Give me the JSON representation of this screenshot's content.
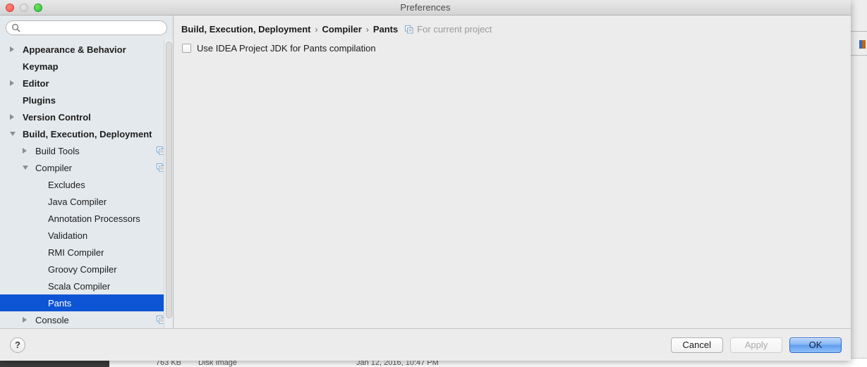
{
  "window": {
    "title": "Preferences",
    "traffic_lights": [
      "close-button",
      "minimize-button",
      "zoom-button"
    ]
  },
  "search": {
    "value": "",
    "placeholder": ""
  },
  "sidebar": {
    "items": [
      {
        "label": "Appearance & Behavior",
        "level": 0,
        "bold": true,
        "twisty": "collapsed",
        "selected": false,
        "scope_icon": false
      },
      {
        "label": "Keymap",
        "level": 0,
        "bold": true,
        "twisty": "none",
        "selected": false,
        "scope_icon": false
      },
      {
        "label": "Editor",
        "level": 0,
        "bold": true,
        "twisty": "collapsed",
        "selected": false,
        "scope_icon": false
      },
      {
        "label": "Plugins",
        "level": 0,
        "bold": true,
        "twisty": "none",
        "selected": false,
        "scope_icon": false
      },
      {
        "label": "Version Control",
        "level": 0,
        "bold": true,
        "twisty": "collapsed",
        "selected": false,
        "scope_icon": false
      },
      {
        "label": "Build, Execution, Deployment",
        "level": 0,
        "bold": true,
        "twisty": "expanded",
        "selected": false,
        "scope_icon": false
      },
      {
        "label": "Build Tools",
        "level": 1,
        "bold": false,
        "twisty": "collapsed",
        "selected": false,
        "scope_icon": true
      },
      {
        "label": "Compiler",
        "level": 1,
        "bold": false,
        "twisty": "expanded",
        "selected": false,
        "scope_icon": true
      },
      {
        "label": "Excludes",
        "level": 2,
        "bold": false,
        "twisty": "none",
        "selected": false,
        "scope_icon": false
      },
      {
        "label": "Java Compiler",
        "level": 2,
        "bold": false,
        "twisty": "none",
        "selected": false,
        "scope_icon": false
      },
      {
        "label": "Annotation Processors",
        "level": 2,
        "bold": false,
        "twisty": "none",
        "selected": false,
        "scope_icon": false
      },
      {
        "label": "Validation",
        "level": 2,
        "bold": false,
        "twisty": "none",
        "selected": false,
        "scope_icon": false
      },
      {
        "label": "RMI Compiler",
        "level": 2,
        "bold": false,
        "twisty": "none",
        "selected": false,
        "scope_icon": false
      },
      {
        "label": "Groovy Compiler",
        "level": 2,
        "bold": false,
        "twisty": "none",
        "selected": false,
        "scope_icon": false
      },
      {
        "label": "Scala Compiler",
        "level": 2,
        "bold": false,
        "twisty": "none",
        "selected": false,
        "scope_icon": false
      },
      {
        "label": "Pants",
        "level": 2,
        "bold": false,
        "twisty": "none",
        "selected": true,
        "scope_icon": false
      },
      {
        "label": "Console",
        "level": 1,
        "bold": false,
        "twisty": "collapsed",
        "selected": false,
        "scope_icon": true
      }
    ],
    "selection_color": "#0d55d4"
  },
  "content": {
    "breadcrumb": {
      "parts": [
        "Build, Execution, Deployment",
        "Compiler",
        "Pants"
      ],
      "separator": "›",
      "scope_note": "For current project"
    },
    "options": [
      {
        "label": "Use IDEA Project JDK for Pants compilation",
        "checked": false
      }
    ]
  },
  "footer": {
    "help_label": "?",
    "cancel_label": "Cancel",
    "apply_label": "Apply",
    "apply_enabled": false,
    "ok_label": "OK"
  },
  "background": {
    "finder_row": {
      "size": "763 KB",
      "kind": "Disk Image",
      "date": "Jan 12, 2016, 10:47 PM"
    }
  }
}
